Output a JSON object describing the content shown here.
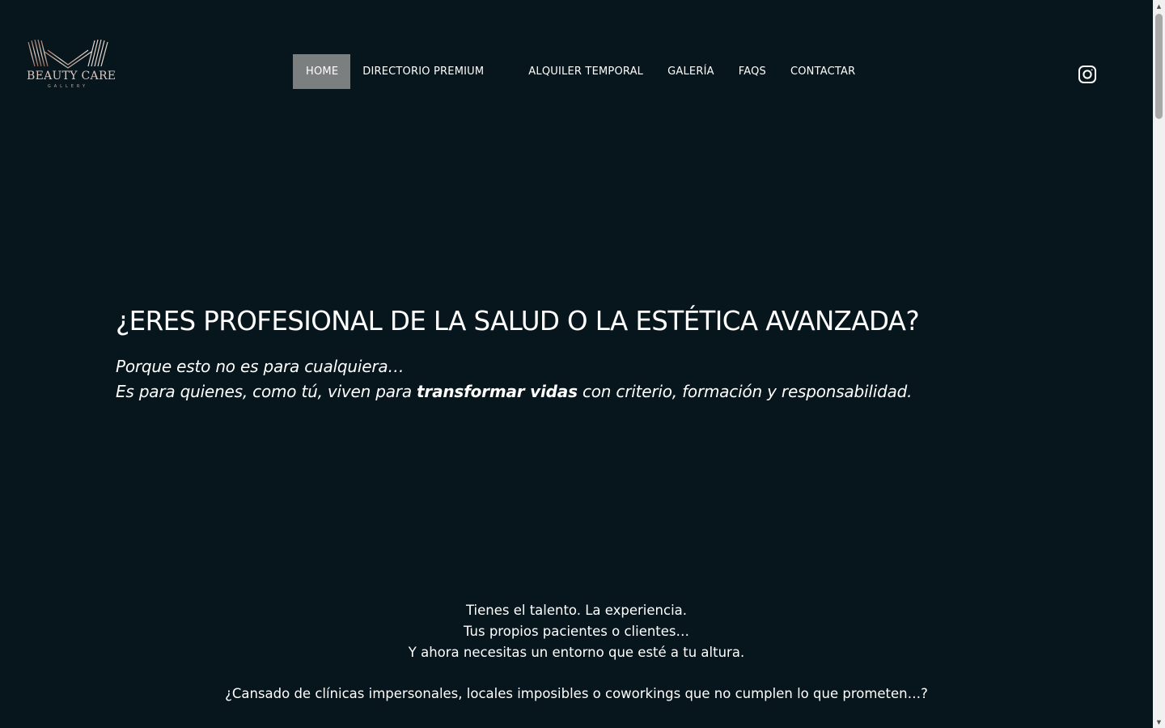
{
  "brand": {
    "name": "BEAUTY CARE",
    "tagline": "GALLERY"
  },
  "nav": {
    "items": [
      {
        "label": "HOME",
        "active": true
      },
      {
        "label": "DIRECTORIO PREMIUM"
      },
      {
        "label": "ALQUILER TEMPORAL"
      },
      {
        "label": "GALERÍA"
      },
      {
        "label": "FAQS"
      },
      {
        "label": "CONTACTAR"
      }
    ]
  },
  "social": {
    "icon": "instagram-icon"
  },
  "hero": {
    "title": "¿ERES PROFESIONAL DE LA SALUD O LA ESTÉTICA AVANZADA?",
    "line1": "Porque esto no es para cualquiera…",
    "line2_before": "Es para quienes, como tú, viven para ",
    "line2_bold": "transformar vidas",
    "line2_after": " con criterio, formación y responsabilidad."
  },
  "body": {
    "lines": [
      "Tienes el talento. La experiencia.",
      "Tus propios pacientes o clientes…",
      "Y ahora necesitas un entorno que esté a tu altura."
    ],
    "question": "¿Cansado de clínicas impersonales, locales imposibles o coworkings que no cumplen lo que prometen…?"
  },
  "colors": {
    "background": "#07151c",
    "nav_active": "#7b7f80",
    "logo_gradient_start": "#c9a08e",
    "logo_gradient_end": "#e8ddd7"
  }
}
